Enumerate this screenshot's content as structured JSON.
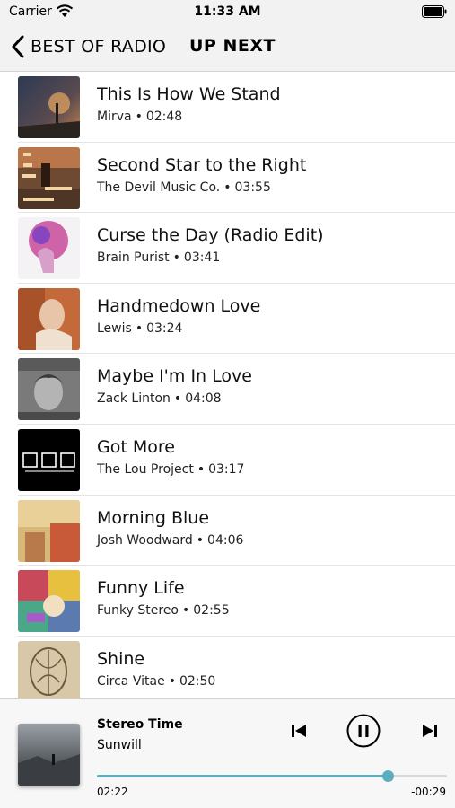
{
  "status_bar": {
    "carrier": "Carrier",
    "time": "11:33 AM"
  },
  "nav": {
    "back_label": "BEST OF RADIO",
    "title": "UP NEXT"
  },
  "tracks": [
    {
      "title": "This Is How We Stand",
      "artist": "Mirva",
      "duration": "02:48",
      "art": "art-1"
    },
    {
      "title": "Second Star to the Right",
      "artist": "The Devil Music Co.",
      "duration": "03:55",
      "art": "art-2"
    },
    {
      "title": "Curse the Day (Radio Edit)",
      "artist": "Brain Purist",
      "duration": "03:41",
      "art": "art-3"
    },
    {
      "title": "Handmedown Love",
      "artist": "Lewis",
      "duration": "03:24",
      "art": "art-4"
    },
    {
      "title": "Maybe I'm In Love",
      "artist": "Zack Linton",
      "duration": "04:08",
      "art": "art-5"
    },
    {
      "title": "Got More",
      "artist": "The Lou Project",
      "duration": "03:17",
      "art": "art-6"
    },
    {
      "title": "Morning Blue",
      "artist": "Josh Woodward",
      "duration": "04:06",
      "art": "art-7"
    },
    {
      "title": "Funny Life",
      "artist": "Funky Stereo",
      "duration": "02:55",
      "art": "art-8"
    },
    {
      "title": "Shine",
      "artist": "Circa Vitae",
      "duration": "02:50",
      "art": "art-9"
    }
  ],
  "separator": "•",
  "player": {
    "title": "Stereo Time",
    "artist": "Sunwill",
    "elapsed": "02:22",
    "remaining": "-00:29",
    "progress": 0.83,
    "accent_color": "#5aaec0",
    "controls": {
      "previous": "skip-previous-icon",
      "pause": "pause-icon",
      "next": "skip-next-icon"
    }
  }
}
